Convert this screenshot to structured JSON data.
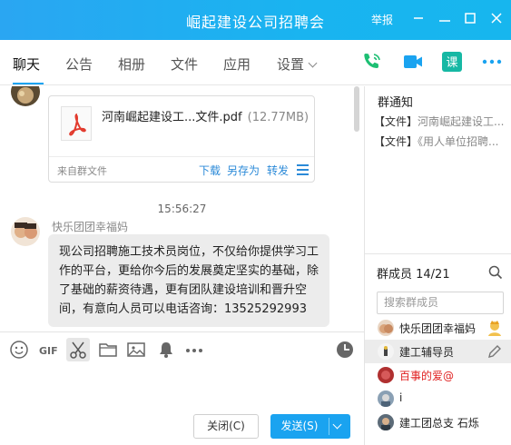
{
  "window": {
    "title": "崛起建设公司招聘会",
    "report_label": "举报"
  },
  "tabs": [
    {
      "label": "聊天",
      "active": true
    },
    {
      "label": "公告"
    },
    {
      "label": "相册"
    },
    {
      "label": "文件"
    },
    {
      "label": "应用"
    },
    {
      "label": "设置"
    }
  ],
  "chat": {
    "file_message": {
      "file_name": "河南崛起建设工...文件.pdf",
      "file_size": "(12.77MB)",
      "source": "来自群文件",
      "actions": [
        "下载",
        "另存为",
        "转发"
      ]
    },
    "timestamp": "15:56:27",
    "message": {
      "sender": "快乐团团幸福妈",
      "lines": [
        "现公司招聘施工技术员岗位，不仅给你提供学习工",
        "作的平台，更给你今后的发展奠定坚实的基础，除",
        "了基础的薪资待遇，更有团队建设培训和晋升空",
        "间，有意向人员可以电话咨询：13525292993"
      ]
    }
  },
  "composer": {
    "close_label": "关闭(C)",
    "send_label": "发送(S)"
  },
  "right_panel": {
    "notice_title": "群通知",
    "notices": [
      {
        "tag": "【文件】",
        "text": "河南崛起建设工..."
      },
      {
        "tag": "【文件】",
        "text": "《用人单位招聘..."
      }
    ],
    "members_title": "群成员 14/21",
    "search_placeholder": "搜索群成员",
    "members": [
      {
        "name": "快乐团团幸福妈",
        "badge": "owner-icon"
      },
      {
        "name": "建工辅导员",
        "selected": true,
        "badge": "edit-icon"
      },
      {
        "name": "百事的爱@",
        "color": "#e02020"
      },
      {
        "name": "i"
      },
      {
        "name": "建工团总支 石烁"
      }
    ]
  },
  "colors": {
    "accent": "#1aa3f0",
    "link": "#2b8ad8",
    "phone_green": "#1dbf73",
    "video_blue": "#1aa3f0",
    "class_teal": "#16b8a4"
  }
}
